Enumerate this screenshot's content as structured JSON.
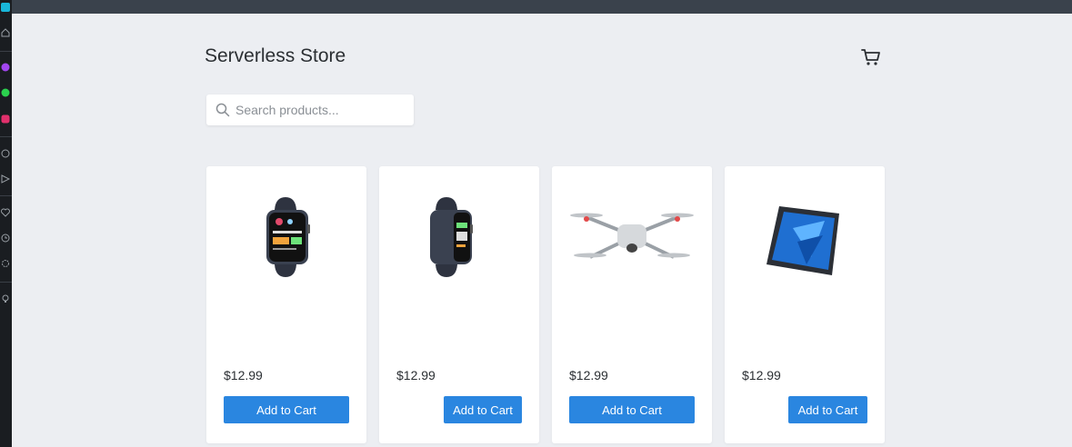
{
  "store": {
    "title": "Serverless Store"
  },
  "search": {
    "placeholder": "Search products..."
  },
  "products": [
    {
      "image": "smartwatch-dark-image",
      "price": "$12.99",
      "button_label": "Add to Cart"
    },
    {
      "image": "smartwatch-dark-image",
      "price": "$12.99",
      "button_label": "Add to Cart"
    },
    {
      "image": "drone-image",
      "price": "$12.99",
      "button_label": "Add to Cart"
    },
    {
      "image": "tablet-image",
      "price": "$12.99",
      "button_label": "Add to Cart"
    }
  ],
  "colors": {
    "accent": "#2a86e0",
    "background": "#eceef2",
    "topbar": "#3a424c"
  }
}
